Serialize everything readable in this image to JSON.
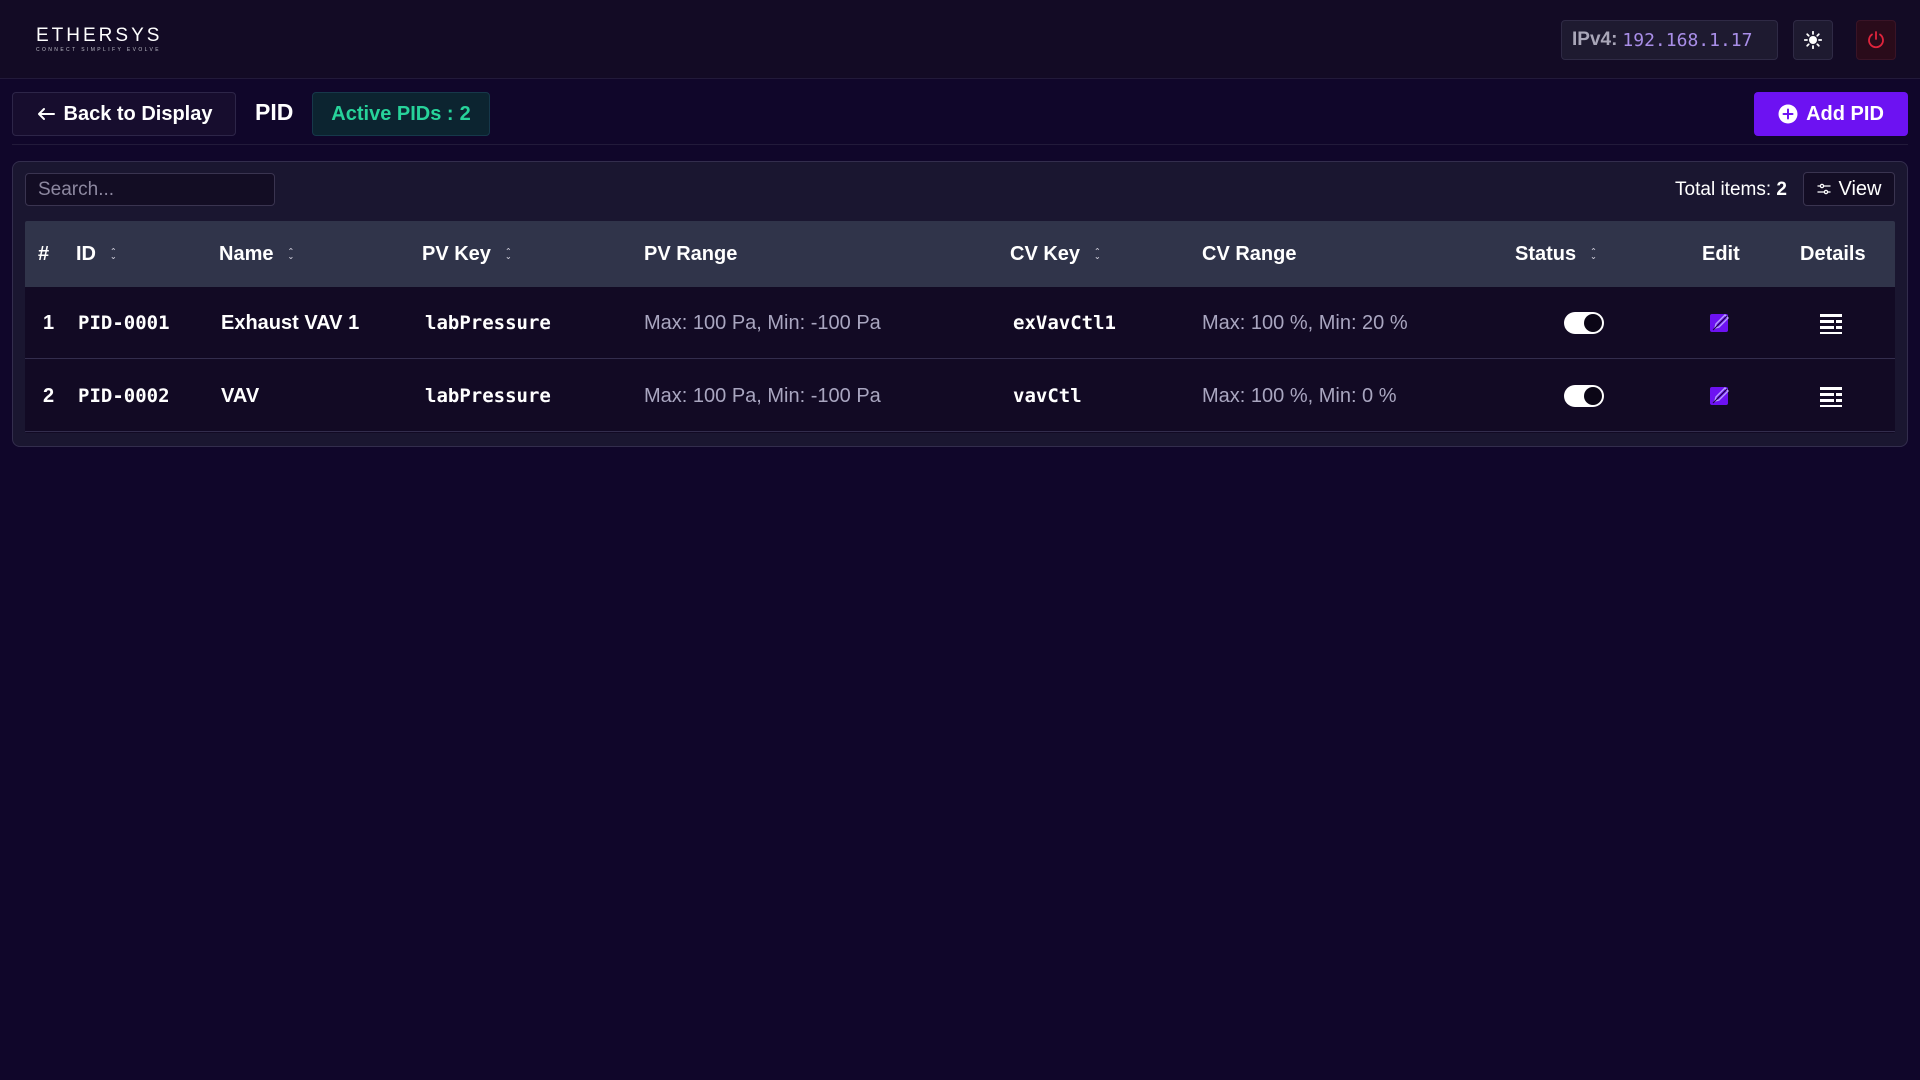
{
  "app": {
    "logo_main": "ETHERSYS",
    "logo_sub": "CONNECT SIMPLIFY EVOLVE"
  },
  "topbar": {
    "ip_label": "IPv4:",
    "ip_value": "192.168.1.17",
    "theme_icon": "sun-icon",
    "power_icon": "power-icon",
    "power_color": "#e0243c"
  },
  "header": {
    "back_label": "Back to Display",
    "page_title": "PID",
    "active_label": "Active PIDs :",
    "active_count": "2",
    "add_label": "Add PID",
    "accent_color": "#6d12f2",
    "active_color": "#27d39a"
  },
  "toolbar": {
    "search_placeholder": "Search...",
    "total_label": "Total items:",
    "total_value": "2",
    "view_label": "View"
  },
  "table": {
    "columns": [
      "#",
      "ID",
      "Name",
      "PV Key",
      "PV Range",
      "CV Key",
      "CV Range",
      "Status",
      "Edit",
      "Details"
    ],
    "rows": [
      {
        "index": "1",
        "id": "PID-0001",
        "name": "Exhaust VAV 1",
        "pv_key": "labPressure",
        "pv_range": "Max: 100 Pa, Min: -100 Pa",
        "cv_key": "exVavCtl1",
        "cv_range": "Max: 100 %, Min: 20 %",
        "status_on": true
      },
      {
        "index": "2",
        "id": "PID-0002",
        "name": "VAV",
        "pv_key": "labPressure",
        "pv_range": "Max: 100 Pa, Min: -100 Pa",
        "cv_key": "vavCtl",
        "cv_range": "Max: 100 %, Min: 0 %",
        "status_on": true
      }
    ]
  }
}
